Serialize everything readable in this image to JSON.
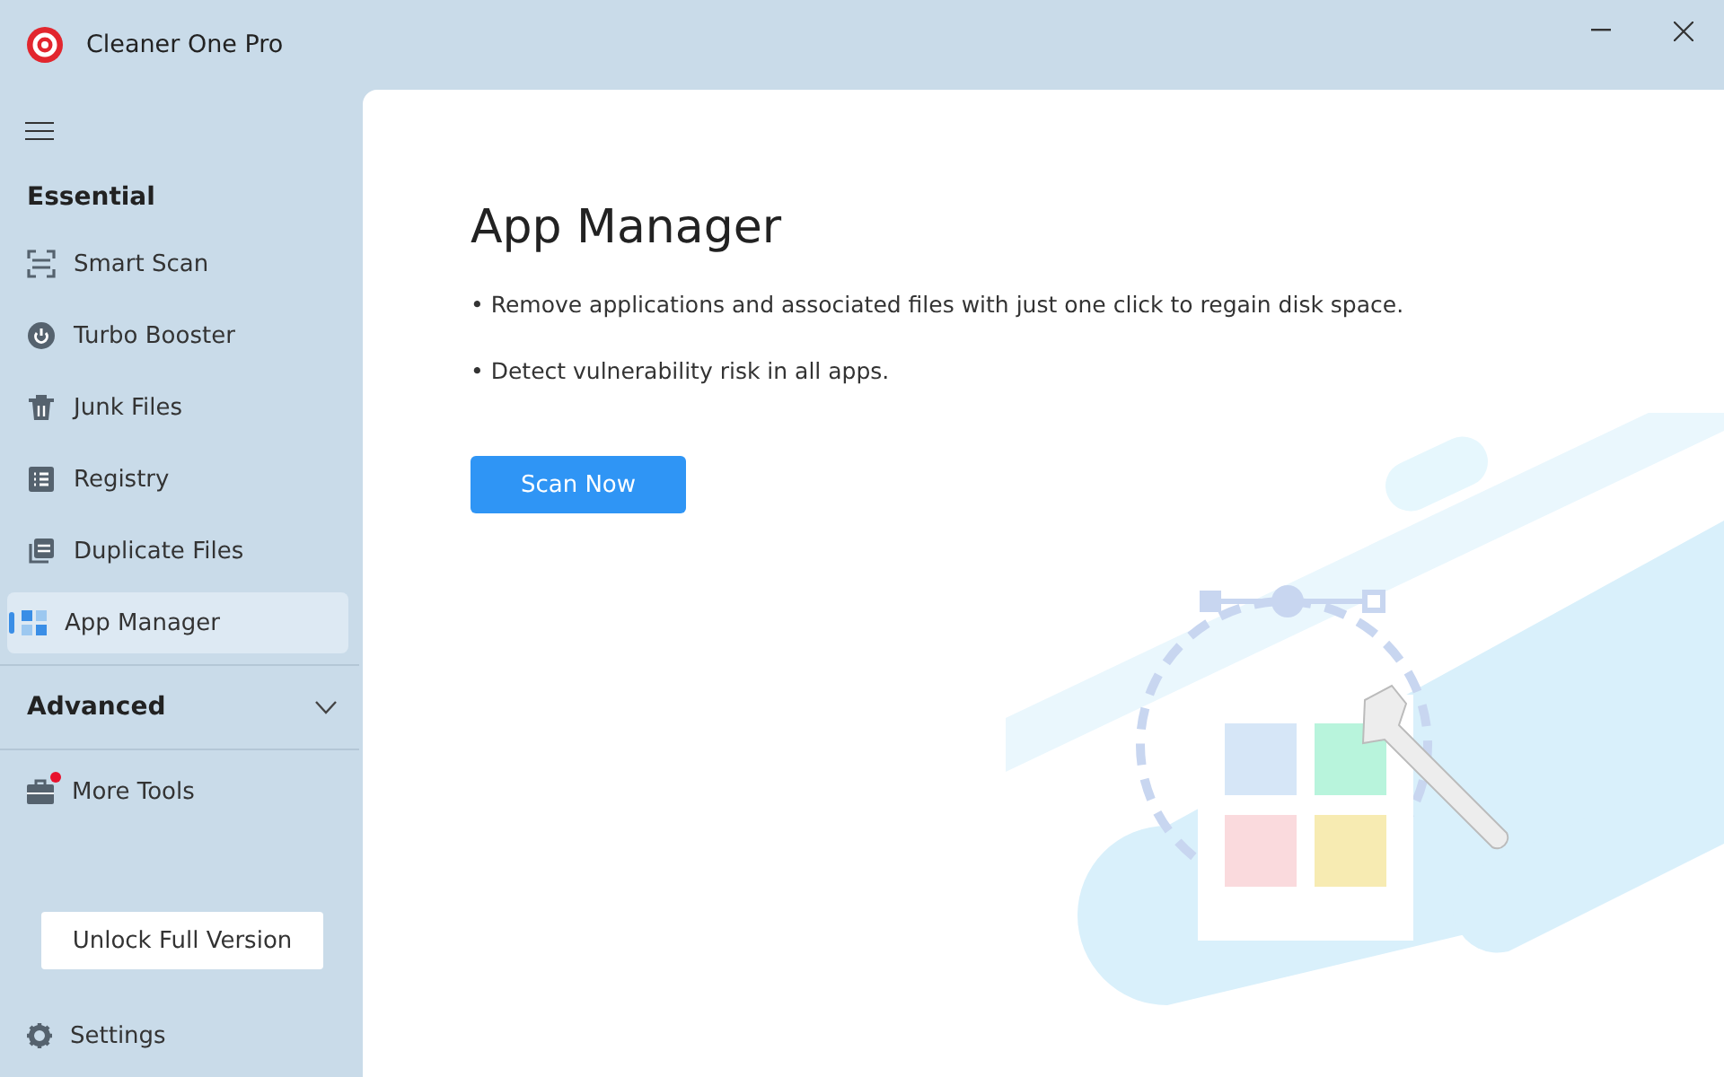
{
  "window": {
    "title": "Cleaner One Pro"
  },
  "sidebar": {
    "sections": [
      {
        "heading": "Essential",
        "items": [
          {
            "label": "Smart Scan",
            "selected": false
          },
          {
            "label": "Turbo Booster",
            "selected": false
          },
          {
            "label": "Junk Files",
            "selected": false
          },
          {
            "label": "Registry",
            "selected": false
          },
          {
            "label": "Duplicate Files",
            "selected": false
          },
          {
            "label": "App Manager",
            "selected": true
          }
        ]
      }
    ],
    "advanced": {
      "label": "Advanced",
      "expanded": false
    },
    "more_tools": {
      "label": "More Tools",
      "notification": true
    },
    "unlock_button": "Unlock Full Version",
    "settings": "Settings"
  },
  "main": {
    "title": "App Manager",
    "bullets": [
      "• Remove applications and associated files with just one click to regain disk space.",
      "• Detect vulnerability risk in all apps."
    ],
    "button": "Scan Now"
  }
}
